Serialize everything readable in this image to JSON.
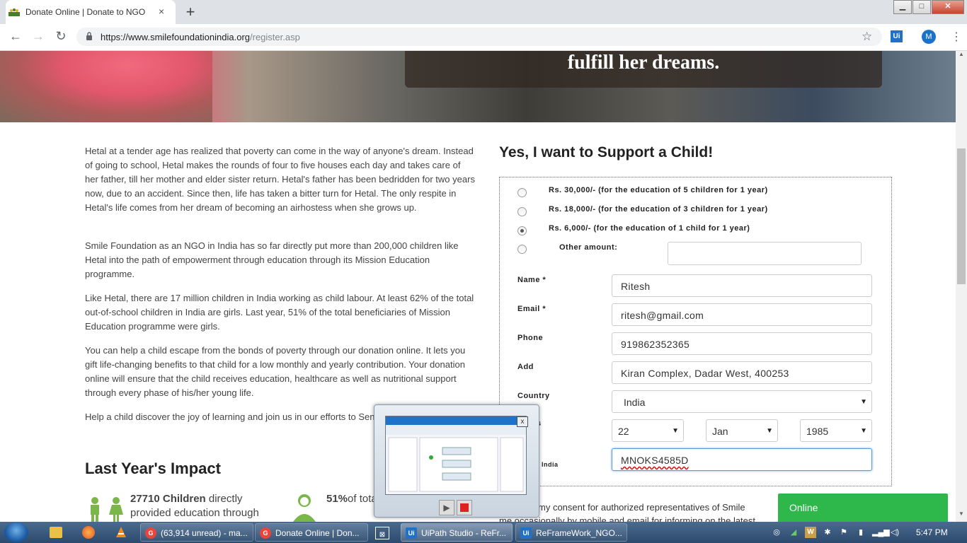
{
  "browser": {
    "tab_title": "Donate Online | Donate to NGO | Smile Foundation",
    "tab_close": "×",
    "new_tab": "+",
    "url_host": "https://www.smilefoundationindia.org",
    "url_path": "/register.asp",
    "back": "←",
    "forward": "→",
    "reload": "↻",
    "star": "☆",
    "ext_label": "Ui",
    "profile_initial": "M",
    "menu": "⋮",
    "win_min": "▁",
    "win_max": "□",
    "win_close": "✕"
  },
  "banner": {
    "caption": "fulfill her dreams."
  },
  "story": {
    "paragraphs": [
      "Hetal at a tender age has realized that poverty can come in the way of anyone's dream. Instead of going to school, Hetal makes the rounds of four to five houses each day and takes care of her father, till her mother and elder sister return. Hetal's father has been bedridden for two years now, due to an accident. Since then, life has taken a bitter turn for Hetal. The only respite in Hetal's life comes from her dream of becoming an airhostess when she grows up.",
      "Smile Foundation as an NGO in India has so far directly put more than 200,000 children like Hetal into the path of empowerment through education through its Mission Education programme.",
      "Like Hetal, there are 17 million children in India working as child labour. At least 62% of the total out-of-school children in India are girls. Last year, 51% of the total beneficiaries of Mission Education programme were girls.",
      "You can help a child escape from the bonds of poverty through our donation online. It lets you gift life-changing benefits to that child for a low monthly and yearly contribution. Your donation online will ensure that the child receives education, healthcare as well as nutritional support through every phase of his/her young life.",
      "Help a child discover the joy of learning and join us in our efforts to Send A Child To School!"
    ]
  },
  "impact": {
    "title": "Last Year's Impact",
    "stat1_bold": "27710 Children",
    "stat1_rest": " directly provided education through",
    "stat2_bold": "51%",
    "stat2_rest": "of total enrolled were girls"
  },
  "form": {
    "title": "Yes, I want to Support a Child!",
    "options": [
      {
        "label": "Rs. 30,000/- (for the education of 5 children for 1 year)",
        "selected": false
      },
      {
        "label": "Rs. 18,000/- (for the education of 3 children for 1 year)",
        "selected": false
      },
      {
        "label": "Rs. 6,000/- (for the education of 1 child for 1 year)",
        "selected": true
      },
      {
        "label": "Other amount:",
        "selected": false
      }
    ],
    "other_amount_value": "",
    "name_label": "Name *",
    "name_value": "Ritesh",
    "email_label": "Email *",
    "email_value": "ritesh@gmail.com",
    "phone_label": "Phone",
    "phone_value": "919862352365",
    "address_label": "Add",
    "address_value": "Kiran Complex, Dadar West, 400253",
    "country_label": "Country",
    "country_value": "India",
    "dob_label": "s",
    "dob_day": "22",
    "dob_month": "Jan",
    "dob_year": "1985",
    "pan_label": "r India",
    "pan_value": "MNOKS4585D",
    "caret": "▼"
  },
  "consent": {
    "line1": "my consent for authorized representatives of Smile",
    "line2": "me occasionally by mobile and email for informing on the latest"
  },
  "chat": {
    "label": "Online"
  },
  "preview": {
    "close": "x",
    "play": "▶"
  },
  "taskbar": {
    "tasks": [
      {
        "label": "(63,914 unread) - ma...",
        "icon_color": "#e8453c"
      },
      {
        "label": "Donate Online | Don...",
        "icon_color": "#e8453c"
      },
      {
        "label": "UiPath Studio - ReFr...",
        "icon_color": "#1e73c8"
      },
      {
        "label": "ReFrameWork_NGO...",
        "icon_color": "#1e73c8"
      }
    ],
    "task_icon_labels": [
      "G",
      "G",
      "Ui",
      "Ui"
    ],
    "clock": "5:47 PM"
  }
}
